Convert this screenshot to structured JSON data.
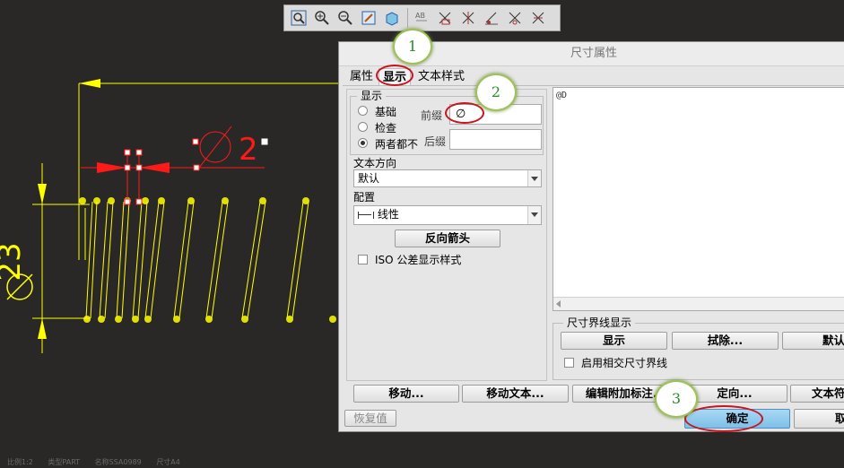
{
  "toolbar": {
    "icons": [
      "zoom-refit-icon",
      "zoom-in-icon",
      "zoom-out-icon",
      "repaint-icon",
      "shading-icon",
      "annotation-display-icon",
      "datum-planes-icon",
      "datum-axes-icon",
      "datum-points-icon",
      "coordinate-systems-icon",
      "spin-center-icon"
    ]
  },
  "drawing": {
    "dim_prefix_text": "2",
    "left_dim_text": "23"
  },
  "dialog": {
    "title": "尺寸属性",
    "tabs": [
      {
        "label": "属性",
        "active": false
      },
      {
        "label": "显示",
        "active": true
      },
      {
        "label": "文本样式",
        "active": false
      }
    ],
    "display_group": {
      "legend": "显示",
      "radios": [
        {
          "label": "基础",
          "selected": false
        },
        {
          "label": "检查",
          "selected": false
        },
        {
          "label": "两者都不",
          "selected": true
        }
      ],
      "prefix_label": "前缀",
      "prefix_value": "∅",
      "suffix_label": "后缀",
      "suffix_value": ""
    },
    "text_direction_label": "文本方向",
    "text_direction_value": "默认",
    "config_label": "配置",
    "config_value": "线性",
    "reverse_arrows_button": "反向箭头",
    "iso_checkbox_label": "ISO 公差显示样式",
    "iso_checked": false,
    "text_area_value": "@D",
    "extension_group": {
      "legend": "尺寸界线显示",
      "show_button": "显示",
      "erase_button": "拭除...",
      "default_button": "默认",
      "intersect_checkbox_label": "启用相交尺寸界线",
      "intersect_checked": false
    },
    "bottom_buttons": {
      "move": "移动...",
      "move_text": "移动文本...",
      "edit_attach": "编辑附加标注...",
      "orient": "定向...",
      "text_symbol": "文本符"
    },
    "restore_button": "恢复值",
    "ok_button": "确定",
    "cancel_button": "取"
  },
  "callouts": [
    "1",
    "2",
    "3"
  ],
  "status_bar": [
    "比例1:2",
    "类型PART",
    "名称SSA0989",
    "尺寸A4"
  ],
  "colors": {
    "canvas_bg": "#2a2827",
    "geometry": "#ffff00",
    "dim_red": "#ff1a1a",
    "dialog_bg": "#e6e6e6",
    "ok_button": "#7fbfe8",
    "callout_border": "#9ec25a",
    "highlight_oval": "#c8141e"
  }
}
